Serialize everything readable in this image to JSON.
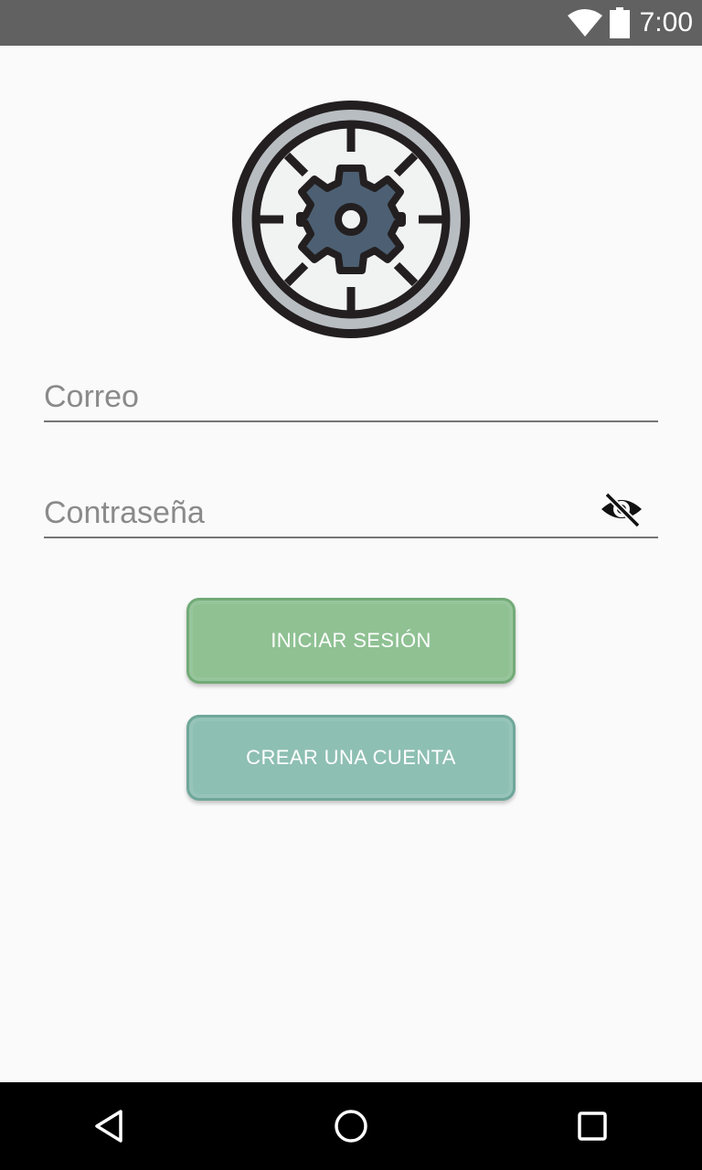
{
  "status_bar": {
    "time": "7:00",
    "icons": [
      "wifi-icon",
      "battery-icon"
    ]
  },
  "logo": {
    "icon": "gear-in-circle-icon",
    "colors": {
      "outline": "#231f20",
      "ring": "#b8bdc2",
      "face": "#f1f2f2",
      "gear": "#4d6073"
    }
  },
  "form": {
    "email": {
      "placeholder": "Correo",
      "value": ""
    },
    "password": {
      "placeholder": "Contraseña",
      "value": "",
      "toggle_icon": "visibility-off-icon"
    }
  },
  "buttons": {
    "login_label": "INICIAR SESIÓN",
    "create_account_label": "CREAR UNA CUENTA"
  },
  "colors": {
    "login_button": "#8fc193",
    "create_button": "#8ebfb3",
    "status_bar": "#616161",
    "background": "#fafafa"
  },
  "nav_bar": {
    "icons": [
      "back-icon",
      "home-icon",
      "recents-icon"
    ]
  }
}
